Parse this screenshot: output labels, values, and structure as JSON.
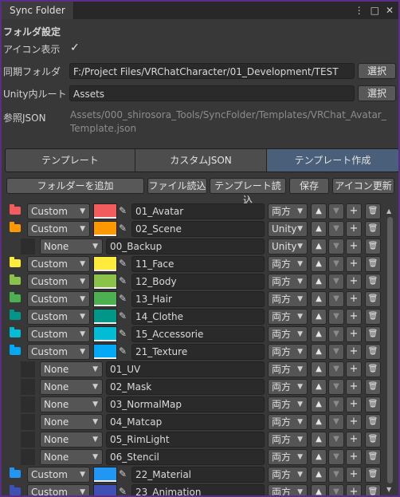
{
  "window": {
    "tab_title": "Sync Folder",
    "menu_icon": "kebab-menu-icon",
    "maximize_icon": "maximize-icon",
    "close_icon": "close-icon"
  },
  "settings": {
    "section_title": "フォルダ設定",
    "icon_display_label": "アイコン表示",
    "icon_display_checked": "✓",
    "sync_folder_label": "同期フォルダ",
    "sync_folder_value": "F:/Project Files/VRChatCharacter/01_Development/TEST",
    "unity_root_label": "Unity内ルート",
    "unity_root_value": "Assets",
    "select_label": "選択",
    "json_label": "参照JSON",
    "json_value_line1": "Assets/000_shirosora_Tools/SyncFolder/Templates/VRChat_Avatar_",
    "json_value_line2": "Template.json"
  },
  "tabs": [
    {
      "label": "テンプレート",
      "active": false
    },
    {
      "label": "カスタムJSON",
      "active": false
    },
    {
      "label": "テンプレート作成",
      "active": true
    }
  ],
  "toolbar": {
    "add_folder": "フォルダーを追加",
    "load_file": "ファイル読込",
    "load_template": "テンプレート読込",
    "save": "保存",
    "update_icons": "アイコン更新"
  },
  "colors": {
    "accent_tab": "#4a5f79"
  },
  "rows": [
    {
      "indent": 0,
      "icon_color": "#f25c5c",
      "mode": "Custom",
      "swatch": "#f25c5c",
      "name": "01_Avatar",
      "sync": "両方"
    },
    {
      "indent": 0,
      "icon_color": "#ff9800",
      "mode": "Custom",
      "swatch": "#ff9800",
      "name": "02_Scene",
      "sync": "Unity"
    },
    {
      "indent": 1,
      "icon_color": "",
      "mode": "None",
      "swatch": "",
      "name": "00_Backup",
      "sync": "Unity"
    },
    {
      "indent": 0,
      "icon_color": "#ffeb3b",
      "mode": "Custom",
      "swatch": "#ffeb3b",
      "name": "11_Face",
      "sync": "両方"
    },
    {
      "indent": 0,
      "icon_color": "#8bc34a",
      "mode": "Custom",
      "swatch": "#8bc34a",
      "name": "12_Body",
      "sync": "両方"
    },
    {
      "indent": 0,
      "icon_color": "#4caf50",
      "mode": "Custom",
      "swatch": "#4caf50",
      "name": "13_Hair",
      "sync": "両方"
    },
    {
      "indent": 0,
      "icon_color": "#009688",
      "mode": "Custom",
      "swatch": "#009688",
      "name": "14_Clothe",
      "sync": "両方"
    },
    {
      "indent": 0,
      "icon_color": "#00bcd4",
      "mode": "Custom",
      "swatch": "#00bcd4",
      "name": "15_Accessorie",
      "sync": "両方"
    },
    {
      "indent": 0,
      "icon_color": "#03a9f4",
      "mode": "Custom",
      "swatch": "#03a9f4",
      "name": "21_Texture",
      "sync": "両方"
    },
    {
      "indent": 1,
      "icon_color": "",
      "mode": "None",
      "swatch": "",
      "name": "01_UV",
      "sync": "両方"
    },
    {
      "indent": 1,
      "icon_color": "",
      "mode": "None",
      "swatch": "",
      "name": "02_Mask",
      "sync": "両方"
    },
    {
      "indent": 1,
      "icon_color": "",
      "mode": "None",
      "swatch": "",
      "name": "03_NormalMap",
      "sync": "両方"
    },
    {
      "indent": 1,
      "icon_color": "",
      "mode": "None",
      "swatch": "",
      "name": "04_Matcap",
      "sync": "両方"
    },
    {
      "indent": 1,
      "icon_color": "",
      "mode": "None",
      "swatch": "",
      "name": "05_RimLight",
      "sync": "両方"
    },
    {
      "indent": 1,
      "icon_color": "",
      "mode": "None",
      "swatch": "",
      "name": "06_Stencil",
      "sync": "両方"
    },
    {
      "indent": 0,
      "icon_color": "#2196f3",
      "mode": "Custom",
      "swatch": "#2196f3",
      "name": "22_Material",
      "sync": "両方"
    },
    {
      "indent": 0,
      "icon_color": "#3f51b5",
      "mode": "Custom",
      "swatch": "#3f51b5",
      "name": "23_Animation",
      "sync": "両方"
    }
  ],
  "row_buttons": {
    "up": "▲",
    "down": "▼",
    "add": "+",
    "delete_icon": "trash-icon"
  }
}
